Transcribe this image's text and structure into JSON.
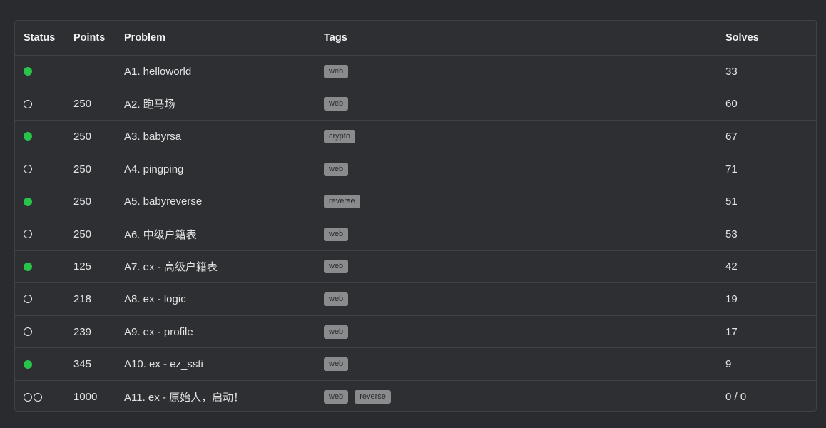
{
  "table": {
    "headers": {
      "status": "Status",
      "points": "Points",
      "problem": "Problem",
      "tags": "Tags",
      "solves": "Solves"
    },
    "rows": [
      {
        "status": [
          "solved"
        ],
        "points": "",
        "problem": "A1. helloworld",
        "tags": [
          "web"
        ],
        "solves": "33"
      },
      {
        "status": [
          "open"
        ],
        "points": "250",
        "problem": "A2. 跑马场",
        "tags": [
          "web"
        ],
        "solves": "60"
      },
      {
        "status": [
          "solved"
        ],
        "points": "250",
        "problem": "A3. babyrsa",
        "tags": [
          "crypto"
        ],
        "solves": "67"
      },
      {
        "status": [
          "open"
        ],
        "points": "250",
        "problem": "A4. pingping",
        "tags": [
          "web"
        ],
        "solves": "71"
      },
      {
        "status": [
          "solved"
        ],
        "points": "250",
        "problem": "A5. babyreverse",
        "tags": [
          "reverse"
        ],
        "solves": "51"
      },
      {
        "status": [
          "open"
        ],
        "points": "250",
        "problem": "A6. 中级户籍表",
        "tags": [
          "web"
        ],
        "solves": "53"
      },
      {
        "status": [
          "solved"
        ],
        "points": "125",
        "problem": "A7. ex - 高级户籍表",
        "tags": [
          "web"
        ],
        "solves": "42"
      },
      {
        "status": [
          "open"
        ],
        "points": "218",
        "problem": "A8. ex - logic",
        "tags": [
          "web"
        ],
        "solves": "19"
      },
      {
        "status": [
          "open"
        ],
        "points": "239",
        "problem": "A9. ex - profile",
        "tags": [
          "web"
        ],
        "solves": "17"
      },
      {
        "status": [
          "solved"
        ],
        "points": "345",
        "problem": "A10. ex - ez_ssti",
        "tags": [
          "web"
        ],
        "solves": "9"
      },
      {
        "status": [
          "open",
          "open"
        ],
        "points": "1000",
        "problem": "A11. ex - 原始人，启动！",
        "tags": [
          "web",
          "reverse"
        ],
        "solves": "0 / 0"
      }
    ]
  },
  "colors": {
    "background": "#2a2b2e",
    "panel": "#2e2f33",
    "solved": "#28c44a",
    "tag_bg": "#8a8b8d"
  }
}
